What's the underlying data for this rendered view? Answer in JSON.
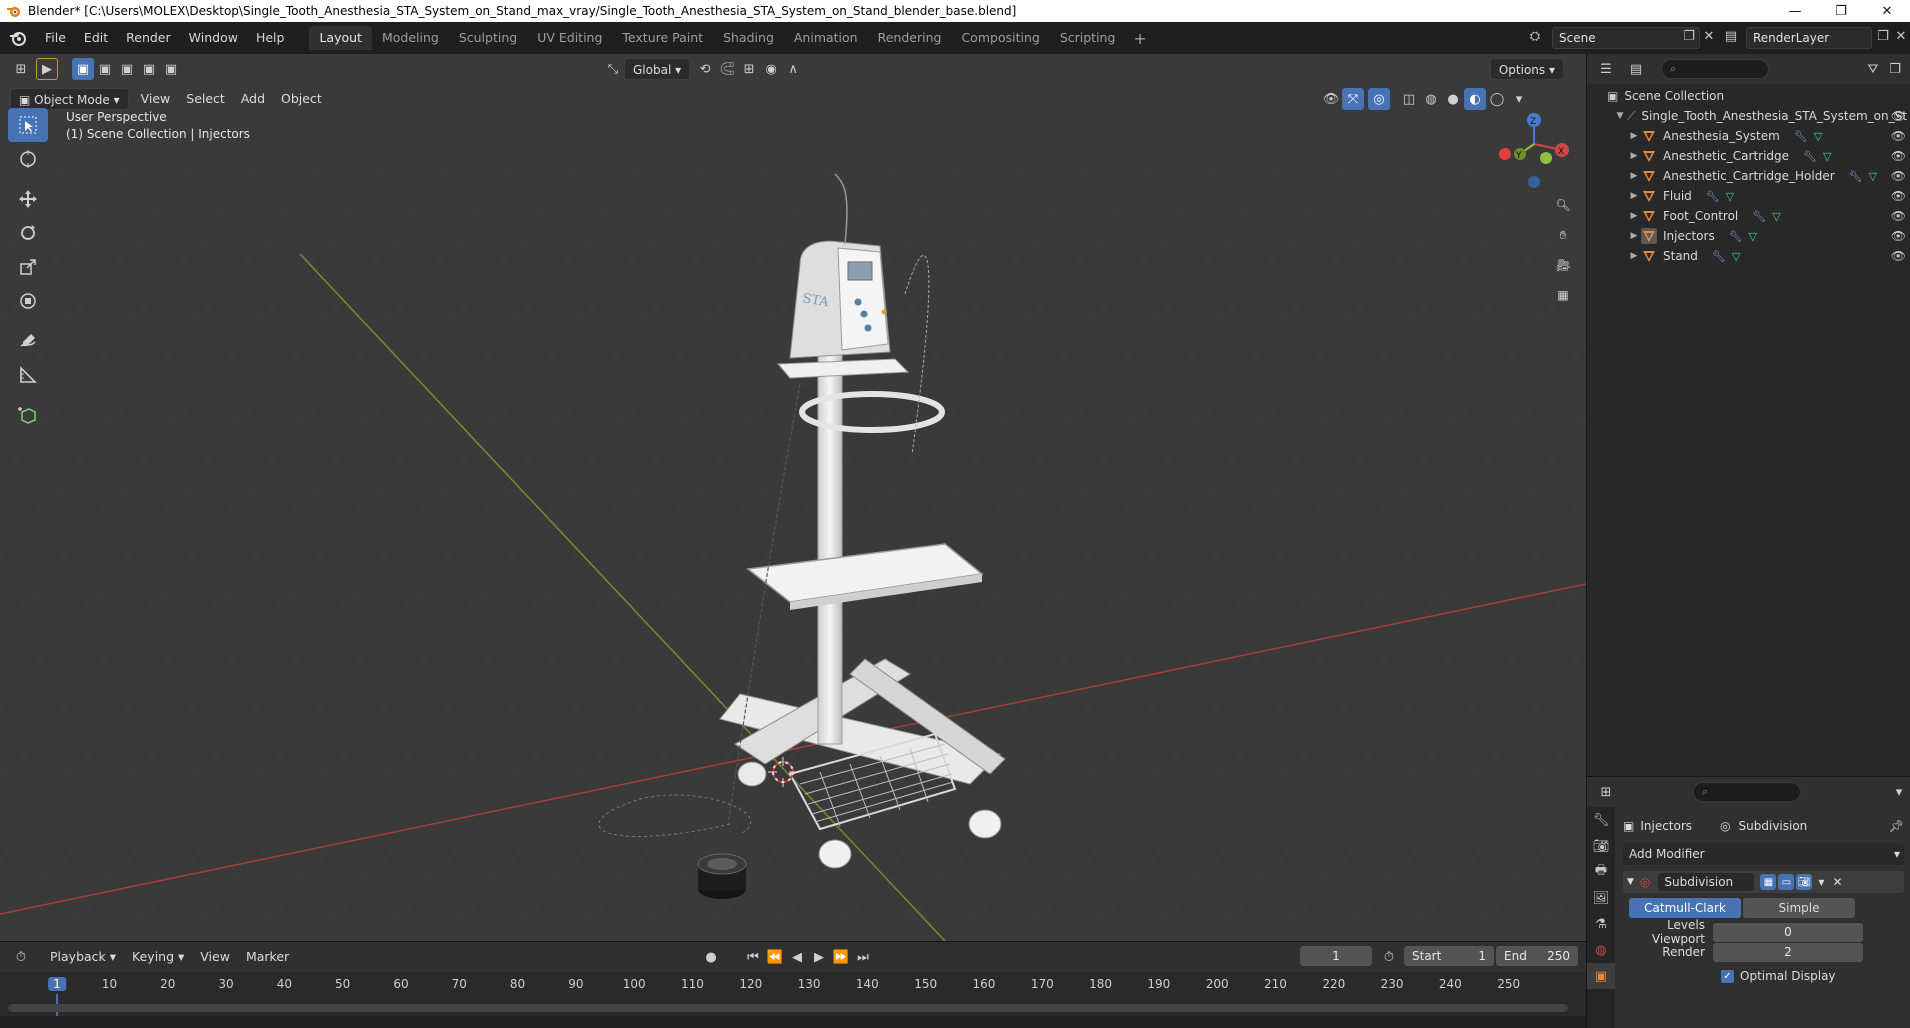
{
  "window": {
    "title": "Blender* [C:\\Users\\MOLEX\\Desktop\\Single_Tooth_Anesthesia_STA_System_on_Stand_max_vray/Single_Tooth_Anesthesia_STA_System_on_Stand_blender_base.blend]",
    "minimize": "—",
    "restore": "❐",
    "close": "✕"
  },
  "menu": [
    "File",
    "Edit",
    "Render",
    "Window",
    "Help"
  ],
  "workspaces": [
    "Layout",
    "Modeling",
    "Sculpting",
    "UV Editing",
    "Texture Paint",
    "Shading",
    "Animation",
    "Rendering",
    "Compositing",
    "Scripting"
  ],
  "active_workspace": "Layout",
  "scene": {
    "name": "Scene",
    "view_layer": "RenderLayer"
  },
  "viewport": {
    "mode": "Object Mode",
    "menus": [
      "View",
      "Select",
      "Add",
      "Object"
    ],
    "transform_orientation": "Global",
    "options_label": "Options",
    "overlay_line1": "User Perspective",
    "overlay_line2": "(1) Scene Collection | Injectors",
    "gizmo": {
      "x": "X",
      "y": "Y",
      "z": "Z"
    }
  },
  "outliner": {
    "root": "Scene Collection",
    "collection": "Single_Tooth_Anesthesia_STA_System_on_St",
    "objects": [
      "Anesthesia_System",
      "Anesthetic_Cartridge",
      "Anesthetic_Cartridge_Holder",
      "Fluid",
      "Foot_Control",
      "Injectors",
      "Stand"
    ]
  },
  "properties": {
    "object_name": "Injectors",
    "modifier_tab": "Subdivision",
    "add_modifier": "Add Modifier",
    "modifier_name": "Subdivision",
    "mode_a": "Catmull-Clark",
    "mode_b": "Simple",
    "levels_viewport_label": "Levels Viewport",
    "levels_viewport_value": "0",
    "render_label": "Render",
    "render_value": "2",
    "optimal_display_label": "Optimal Display"
  },
  "timeline": {
    "menus": [
      "Playback",
      "Keying",
      "View",
      "Marker"
    ],
    "current_frame": "1",
    "start_label": "Start",
    "start_value": "1",
    "end_label": "End",
    "end_value": "250",
    "ruler": [
      "1",
      "10",
      "20",
      "30",
      "40",
      "50",
      "60",
      "70",
      "80",
      "90",
      "100",
      "110",
      "120",
      "130",
      "140",
      "150",
      "160",
      "170",
      "180",
      "190",
      "200",
      "210",
      "220",
      "230",
      "240",
      "250"
    ]
  },
  "colors": {
    "accent": "#4772b3",
    "object_icon": "#e8883a",
    "axis_x": "#c03a3a",
    "axis_y": "#6e9a2a",
    "modifier_icon": "#7fa0e6",
    "mesh_icon": "#3fd49a"
  }
}
